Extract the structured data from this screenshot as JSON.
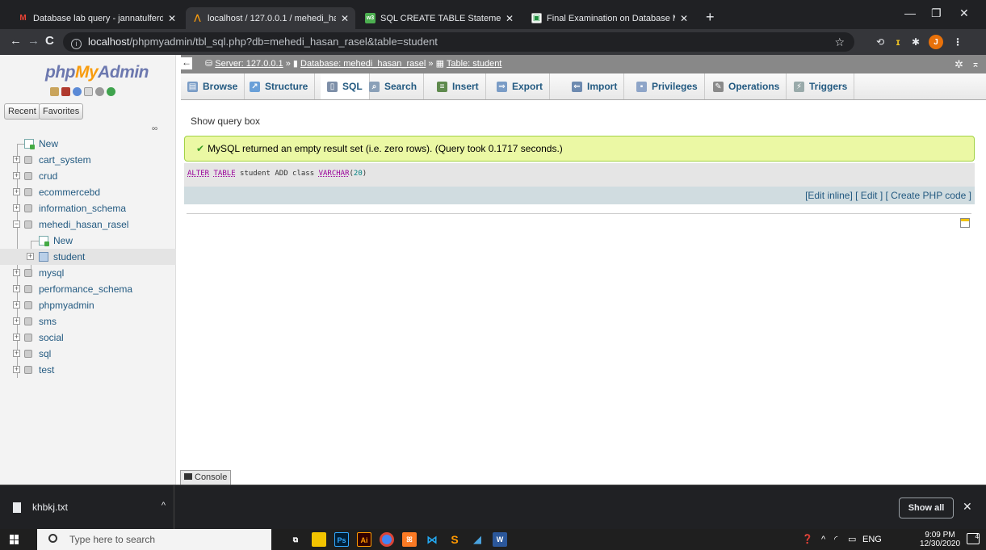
{
  "browser": {
    "tabs": [
      {
        "title": "Database lab query - jannatulferd",
        "favicon": "gmail-icon"
      },
      {
        "title": "localhost / 127.0.0.1 / mehedi_ha",
        "favicon": "phpmyadmin-icon",
        "active": true
      },
      {
        "title": "SQL CREATE TABLE Statement",
        "favicon": "w3schools-icon"
      },
      {
        "title": "Final Examination on Database M",
        "favicon": "classroom-icon"
      }
    ],
    "url_host": "localhost",
    "url_path": "/phpmyadmin/tbl_sql.php?db=mehedi_hasan_rasel&table=student",
    "profile_initial": "J"
  },
  "pma": {
    "logo_php": "php",
    "logo_my": "My",
    "logo_admin": "Admin",
    "recent_label": "Recent",
    "favorites_label": "Favorites",
    "tree": [
      {
        "label": "New",
        "type": "new",
        "level": 0
      },
      {
        "label": "cart_system",
        "type": "db",
        "level": 0
      },
      {
        "label": "crud",
        "type": "db",
        "level": 0
      },
      {
        "label": "ecommercebd",
        "type": "db",
        "level": 0
      },
      {
        "label": "information_schema",
        "type": "db",
        "level": 0
      },
      {
        "label": "mehedi_hasan_rasel",
        "type": "db-open",
        "level": 0
      },
      {
        "label": "New",
        "type": "new",
        "level": 1
      },
      {
        "label": "student",
        "type": "table",
        "level": 1,
        "selected": true
      },
      {
        "label": "mysql",
        "type": "db",
        "level": 0
      },
      {
        "label": "performance_schema",
        "type": "db",
        "level": 0
      },
      {
        "label": "phpmyadmin",
        "type": "db",
        "level": 0
      },
      {
        "label": "sms",
        "type": "db",
        "level": 0
      },
      {
        "label": "social",
        "type": "db",
        "level": 0
      },
      {
        "label": "sql",
        "type": "db",
        "level": 0
      },
      {
        "label": "test",
        "type": "db",
        "level": 0
      }
    ],
    "breadcrumb": {
      "server_label": "Server: 127.0.0.1",
      "database_label": "Database: mehedi_hasan_rasel",
      "table_label": "Table: student",
      "sep": "»"
    },
    "menu": [
      {
        "label": "Browse",
        "icon": "browse-icon",
        "color": "#7a9cc6"
      },
      {
        "label": "Structure",
        "icon": "structure-icon",
        "color": "#6aa0d8"
      },
      {
        "label": "SQL",
        "icon": "sql-icon",
        "color": "#7d8fa8",
        "active": true
      },
      {
        "label": "Search",
        "icon": "search-icon",
        "color": "#8aa0b8"
      },
      {
        "label": "Insert",
        "icon": "insert-icon",
        "color": "#5f8a4e"
      },
      {
        "label": "Export",
        "icon": "export-icon",
        "color": "#7a9cc6"
      },
      {
        "label": "Import",
        "icon": "import-icon",
        "color": "#6d8ab0"
      },
      {
        "label": "Privileges",
        "icon": "privileges-icon",
        "color": "#8ea5c8"
      },
      {
        "label": "Operations",
        "icon": "operations-icon",
        "color": "#8a8a8a"
      },
      {
        "label": "Triggers",
        "icon": "triggers-icon",
        "color": "#9aa"
      }
    ],
    "show_query_box": "Show query box",
    "success_message": "MySQL returned an empty result set (i.e. zero rows). (Query took 0.1717 seconds.)",
    "sql": {
      "kw1": "ALTER",
      "kw2": "TABLE",
      "mid": " student ADD class ",
      "kw3": "VARCHAR",
      "paren_open": "(",
      "num": "20",
      "paren_close": ")"
    },
    "sql_links": {
      "edit_inline": "[Edit inline]",
      "edit": "[ Edit ]",
      "create_php": "[ Create PHP code ]"
    },
    "console_label": "Console"
  },
  "downloads": {
    "file_name": "khbkj.txt",
    "show_all": "Show all"
  },
  "taskbar": {
    "search_placeholder": "Type here to search",
    "lang": "ENG",
    "time": "9:09 PM",
    "date": "12/30/2020",
    "notifications": "4"
  }
}
